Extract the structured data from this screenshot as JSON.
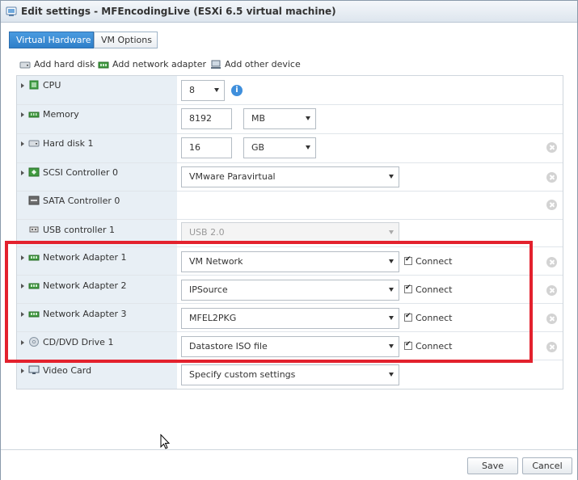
{
  "window": {
    "title": "Edit settings - MFEncodingLive (ESXi 6.5 virtual machine)"
  },
  "tabs": [
    {
      "label": "Virtual Hardware",
      "active": true
    },
    {
      "label": "VM Options",
      "active": false
    }
  ],
  "toolbar": {
    "add_hard_disk": "Add hard disk",
    "add_network_adapter": "Add network adapter",
    "add_other_device": "Add other device"
  },
  "devices": {
    "cpu": {
      "label": "CPU",
      "value": "8",
      "icon": "cpu-icon"
    },
    "memory": {
      "label": "Memory",
      "value": "8192",
      "unit": "MB",
      "icon": "memory-icon"
    },
    "hard_disk_1": {
      "label": "Hard disk 1",
      "value": "16",
      "unit": "GB",
      "icon": "hard-disk-icon"
    },
    "scsi_controller_0": {
      "label": "SCSI Controller 0",
      "value": "VMware Paravirtual",
      "icon": "scsi-controller-icon"
    },
    "sata_controller_0": {
      "label": "SATA Controller 0",
      "icon": "sata-controller-icon"
    },
    "usb_controller_1": {
      "label": "USB controller 1",
      "value": "USB 2.0",
      "disabled": true,
      "icon": "usb-icon"
    },
    "network_adapter_1": {
      "label": "Network Adapter 1",
      "value": "VM Network",
      "connect_label": "Connect",
      "connected": true,
      "icon": "network-adapter-icon"
    },
    "network_adapter_2": {
      "label": "Network Adapter 2",
      "value": "IPSource",
      "connect_label": "Connect",
      "connected": true,
      "icon": "network-adapter-icon"
    },
    "network_adapter_3": {
      "label": "Network Adapter 3",
      "value": "MFEL2PKG",
      "connect_label": "Connect",
      "connected": true,
      "icon": "network-adapter-icon"
    },
    "cd_dvd_drive_1": {
      "label": "CD/DVD Drive 1",
      "value": "Datastore ISO file",
      "connect_label": "Connect",
      "connected": true,
      "icon": "cd-dvd-icon"
    },
    "video_card": {
      "label": "Video Card",
      "value": "Specify custom settings",
      "icon": "monitor-icon"
    }
  },
  "footer": {
    "save_label": "Save",
    "cancel_label": "Cancel"
  },
  "colors": {
    "highlight_border": "#e3212d",
    "active_tab": "#2f7fc9",
    "left_column_bg": "#e8eff5",
    "info_icon": "#3f8fdc"
  }
}
